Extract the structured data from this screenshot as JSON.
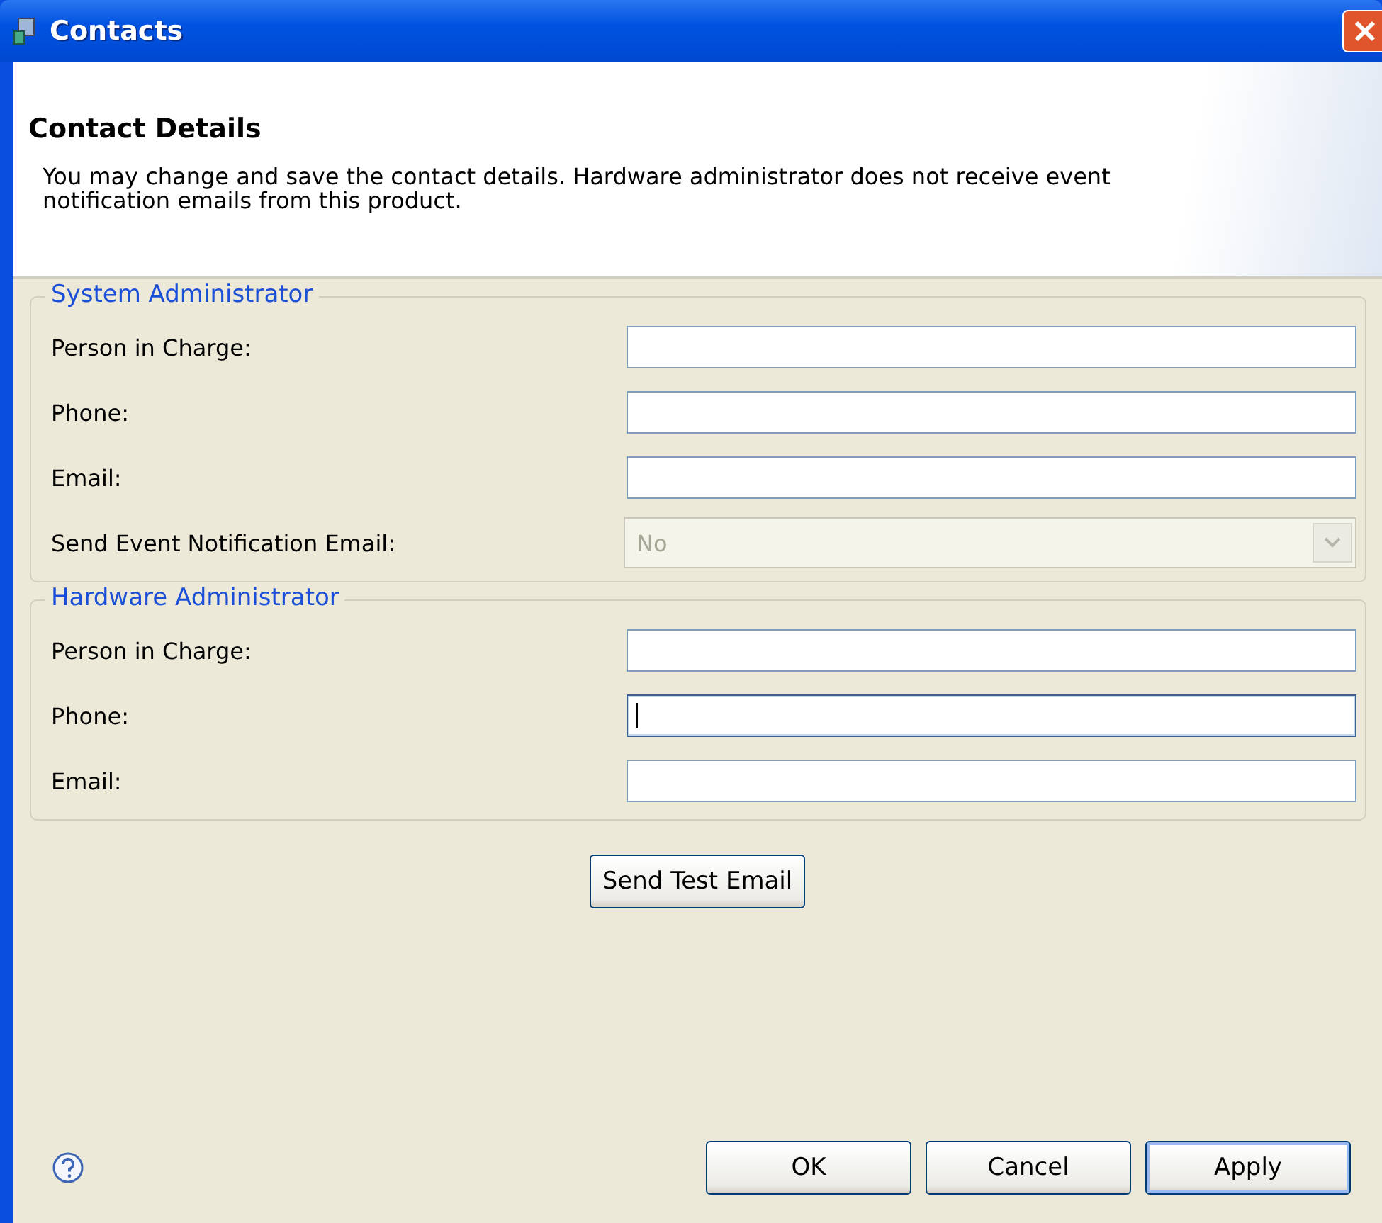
{
  "window": {
    "title": "Contacts"
  },
  "header": {
    "title": "Contact Details",
    "description": "You may change and save the contact details. Hardware administrator does not receive event notification emails from this product."
  },
  "groups": [
    {
      "title": "System Administrator",
      "fields": [
        {
          "kind": "text",
          "label": "Person in Charge:",
          "focused": false
        },
        {
          "kind": "text",
          "label": "Phone:",
          "focused": false
        },
        {
          "kind": "text",
          "label": "Email:",
          "focused": false
        },
        {
          "kind": "select",
          "label": "Send Event Notification Email:",
          "value": "No",
          "disabled": true
        }
      ]
    },
    {
      "title": "Hardware Administrator",
      "fields": [
        {
          "kind": "text",
          "label": "Person in Charge:",
          "focused": false
        },
        {
          "kind": "text",
          "label": "Phone:",
          "focused": true
        },
        {
          "kind": "text",
          "label": "Email:",
          "focused": false
        }
      ]
    }
  ],
  "test_button": "Send Test Email",
  "buttons": [
    {
      "label": "OK",
      "default": false
    },
    {
      "label": "Cancel",
      "default": false
    },
    {
      "label": "Apply",
      "default": true
    }
  ]
}
